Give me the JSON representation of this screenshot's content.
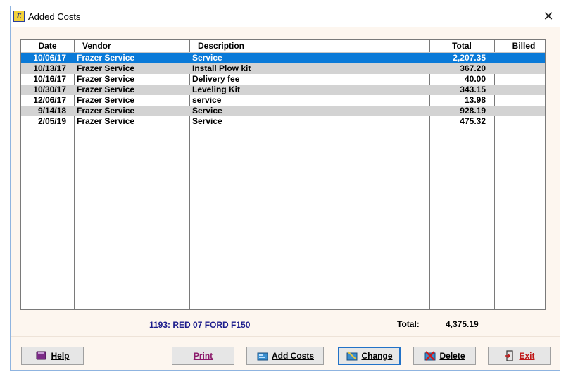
{
  "window": {
    "title": "Added Costs",
    "close_glyph": "✕",
    "app_icon": "app-logo-icon",
    "app_icon_letter": "E"
  },
  "table": {
    "headers": {
      "date": "Date",
      "vendor": "Vendor",
      "description": "Description",
      "total": "Total",
      "billed": "Billed"
    },
    "rows": [
      {
        "date": "10/06/17",
        "vendor": "Frazer Service",
        "description": "Service",
        "total": "2,207.35",
        "billed": ""
      },
      {
        "date": "10/13/17",
        "vendor": "Frazer Service",
        "description": "Install Plow kit",
        "total": "367.20",
        "billed": ""
      },
      {
        "date": "10/16/17",
        "vendor": "Frazer Service",
        "description": "Delivery fee",
        "total": "40.00",
        "billed": ""
      },
      {
        "date": "10/30/17",
        "vendor": "Frazer Service",
        "description": "Leveling Kit",
        "total": "343.15",
        "billed": ""
      },
      {
        "date": "12/06/17",
        "vendor": "Frazer Service",
        "description": "service",
        "total": "13.98",
        "billed": ""
      },
      {
        "date": "9/14/18",
        "vendor": "Frazer Service",
        "description": "Service",
        "total": "928.19",
        "billed": ""
      },
      {
        "date": "2/05/19",
        "vendor": "Frazer Service",
        "description": "Service",
        "total": "475.32",
        "billed": ""
      }
    ],
    "selected_index": 0
  },
  "footer": {
    "vehicle": "1193: RED 07 FORD F150",
    "total_label": "Total:",
    "total_value": "4,375.19"
  },
  "buttons": {
    "help": {
      "label": "Help",
      "icon": "book-icon"
    },
    "print": {
      "label": "Print"
    },
    "add_costs": {
      "label": "Add Costs",
      "icon": "add-costs-icon"
    },
    "change": {
      "label": "Change",
      "icon": "edit-icon"
    },
    "delete": {
      "label": "Delete",
      "icon": "delete-x-icon"
    },
    "exit": {
      "label": "Exit",
      "icon": "exit-door-icon"
    }
  },
  "colors": {
    "selected_row": "#0a7ad8",
    "alt_row": "#d3d3d3",
    "caption": "#1c1c8c",
    "print_text": "#8b1a6b",
    "exit_text": "#c01818"
  }
}
